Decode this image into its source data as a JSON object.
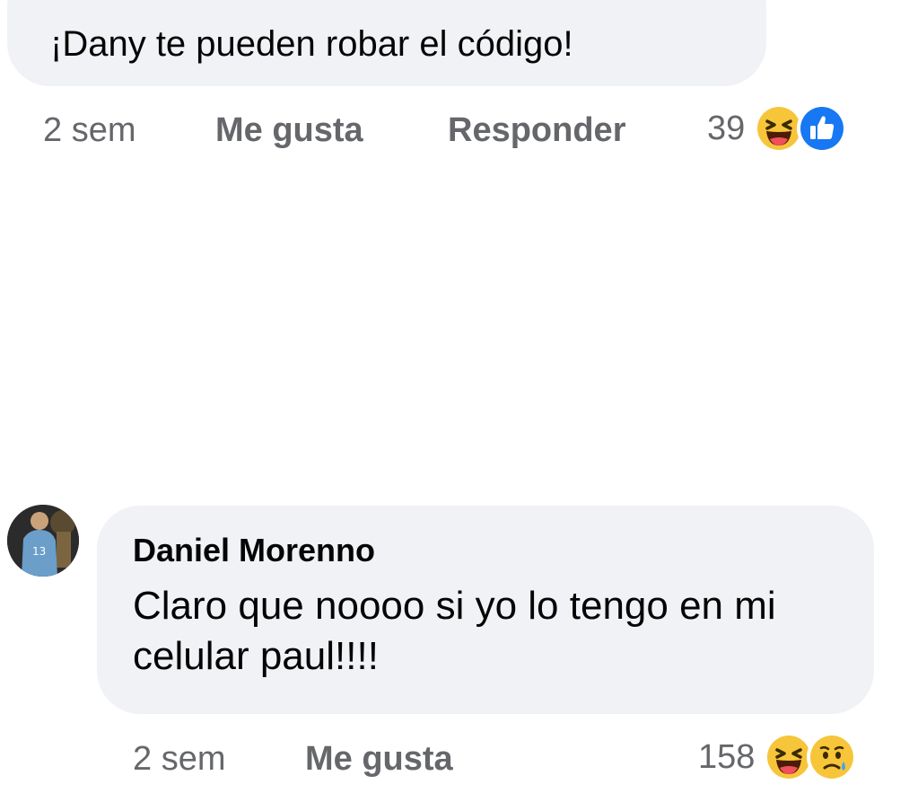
{
  "comment_top": {
    "text": "¡Dany te pueden robar el código!",
    "time": "2 sem",
    "like_label": "Me gusta",
    "reply_label": "Responder",
    "reaction_count": "39",
    "reaction_icons": [
      "laugh-emoji-icon",
      "like-thumb-icon"
    ]
  },
  "comment_reply": {
    "author": "Daniel Morenno",
    "text": "Claro que noooo si yo lo tengo en mi celular paul!!!!",
    "time": "2 sem",
    "like_label": "Me gusta",
    "reaction_count": "158",
    "reaction_icons": [
      "laugh-emoji-icon",
      "sad-emoji-icon"
    ]
  },
  "colors": {
    "bubble": "#f0f2f5",
    "text_primary": "#050505",
    "text_secondary": "#65676b",
    "like_blue": "#1877f2",
    "emoji_yellow": "#f7c53a"
  }
}
